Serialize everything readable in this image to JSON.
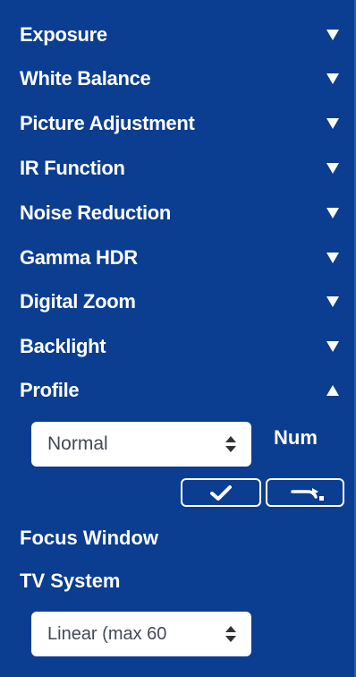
{
  "sections": [
    {
      "label": "Exposure",
      "state": "collapsed"
    },
    {
      "label": "White Balance",
      "state": "collapsed"
    },
    {
      "label": "Picture Adjustment",
      "state": "collapsed"
    },
    {
      "label": "IR Function",
      "state": "collapsed"
    },
    {
      "label": "Noise Reduction",
      "state": "collapsed"
    },
    {
      "label": "Gamma HDR",
      "state": "collapsed"
    },
    {
      "label": "Digital Zoom",
      "state": "collapsed"
    },
    {
      "label": "Backlight",
      "state": "collapsed"
    },
    {
      "label": "Profile",
      "state": "expanded"
    }
  ],
  "profile": {
    "select_value": "Normal",
    "num_label": "Num",
    "confirm_icon": "checkmark-icon",
    "apply_icon": "redo-arrow-icon"
  },
  "focus_window_label": "Focus Window",
  "tv_system": {
    "label": "TV System",
    "select_value": "Linear (max 60"
  },
  "colors": {
    "panel_bg": "#0b3d91",
    "text": "#ffffff"
  }
}
